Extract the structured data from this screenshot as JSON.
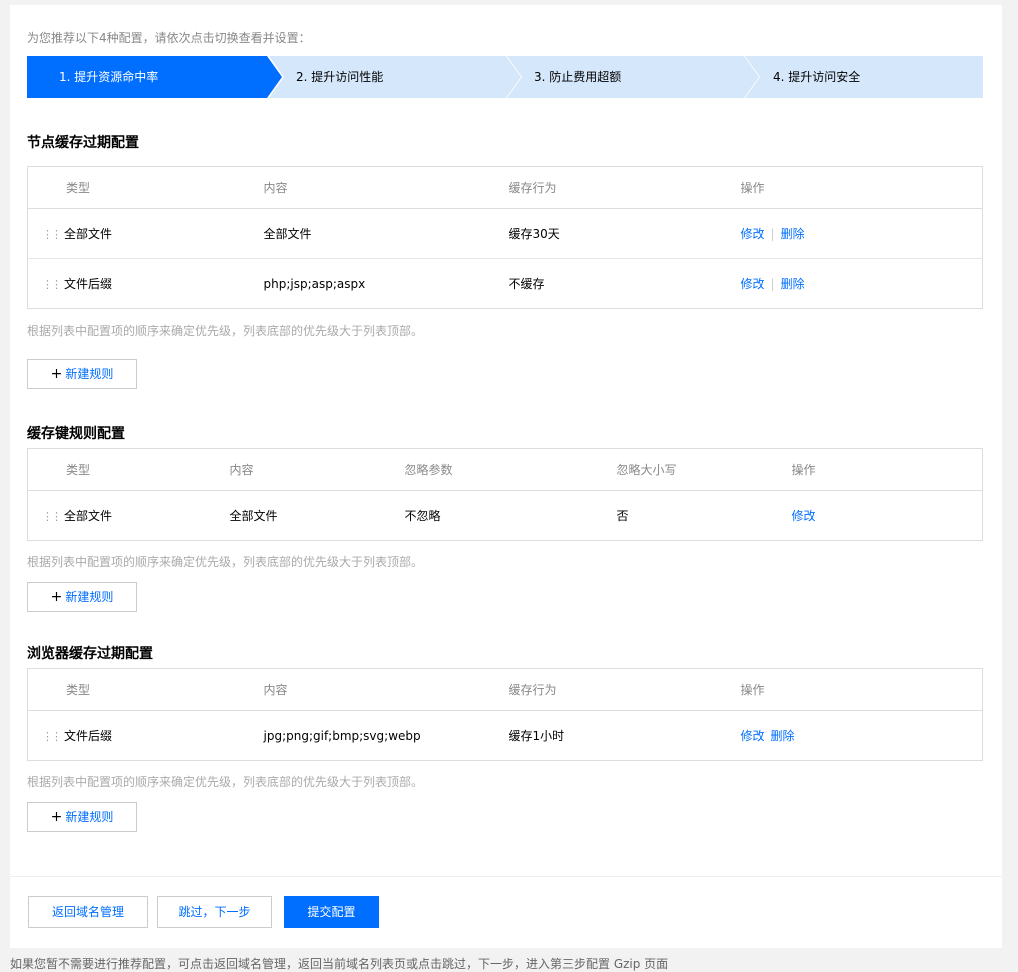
{
  "intro": "为您推荐以下4种配置，请依次点击切换查看并设置：",
  "steps": [
    {
      "label": "1. 提升资源命中率",
      "active": true
    },
    {
      "label": "2. 提升访问性能",
      "active": false
    },
    {
      "label": "3. 防止费用超额",
      "active": false
    },
    {
      "label": "4. 提升访问安全",
      "active": false
    }
  ],
  "node_cache": {
    "title": "节点缓存过期配置",
    "headers": [
      "类型",
      "内容",
      "缓存行为",
      "操作"
    ],
    "rows": [
      {
        "type": "全部文件",
        "content": "全部文件",
        "behavior": "缓存30天",
        "edit": "修改",
        "delete": "删除"
      },
      {
        "type": "文件后缀",
        "content": "php;jsp;asp;aspx",
        "behavior": "不缓存",
        "edit": "修改",
        "delete": "删除"
      }
    ],
    "hint": "根据列表中配置项的顺序来确定优先级，列表底部的优先级大于列表顶部。",
    "add_label": "新建规则"
  },
  "cache_key": {
    "title": "缓存键规则配置",
    "headers": [
      "类型",
      "内容",
      "忽略参数",
      "忽略大小写",
      "操作"
    ],
    "rows": [
      {
        "type": "全部文件",
        "content": "全部文件",
        "ignore_params": "不忽略",
        "ignore_case": "否",
        "edit": "修改"
      }
    ],
    "hint": "根据列表中配置项的顺序来确定优先级，列表底部的优先级大于列表顶部。",
    "add_label": "新建规则"
  },
  "browser_cache": {
    "title": "浏览器缓存过期配置",
    "headers": [
      "类型",
      "内容",
      "缓存行为",
      "操作"
    ],
    "rows": [
      {
        "type": "文件后缀",
        "content": "jpg;png;gif;bmp;svg;webp",
        "behavior": "缓存1小时",
        "edit": "修改",
        "delete": "删除"
      }
    ],
    "hint": "根据列表中配置项的顺序来确定优先级，列表底部的优先级大于列表顶部。",
    "add_label": "新建规则"
  },
  "footer": {
    "back_label": "返回域名管理",
    "skip_label": "跳过，下一步",
    "submit_label": "提交配置"
  },
  "bottom_note": "如果您暂不需要进行推荐配置，可点击返回域名管理，返回当前域名列表页或点击跳过，下一步，进入第三步配置 Gzip 页面",
  "colors": {
    "accent": "#006eff",
    "step_inactive": "#d5e7fb"
  }
}
